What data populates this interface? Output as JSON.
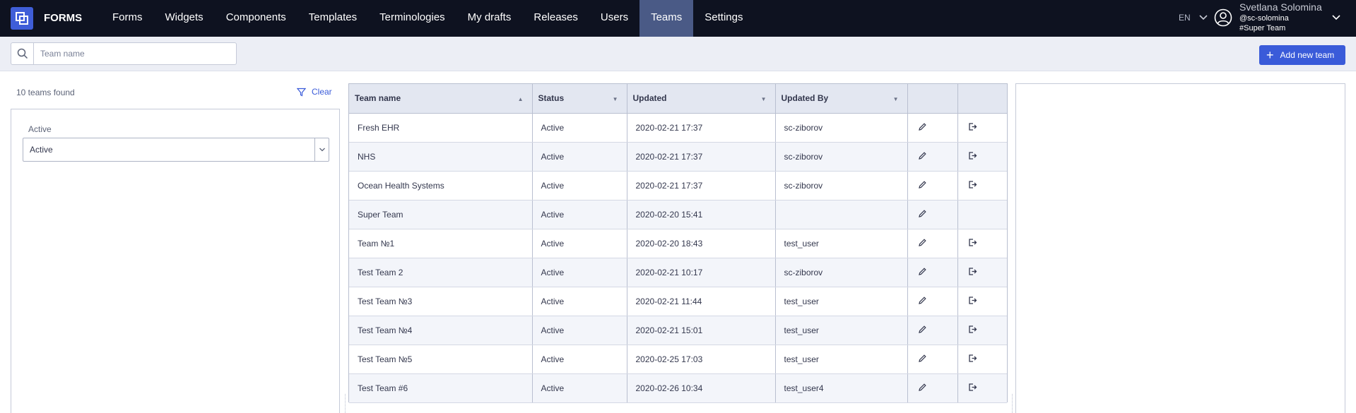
{
  "app": {
    "brand": "FORMS",
    "nav": [
      {
        "label": "Forms"
      },
      {
        "label": "Widgets"
      },
      {
        "label": "Components"
      },
      {
        "label": "Templates"
      },
      {
        "label": "Terminologies"
      },
      {
        "label": "My drafts"
      },
      {
        "label": "Releases"
      },
      {
        "label": "Users"
      },
      {
        "label": "Teams",
        "active": true
      },
      {
        "label": "Settings"
      }
    ],
    "language": "EN",
    "user": {
      "name": "Svetlana Solomina",
      "handle": "@sc-solomina",
      "team": "#Super Team"
    }
  },
  "search": {
    "placeholder": "Team name",
    "value": ""
  },
  "toolbar": {
    "add_label": "Add new team"
  },
  "filters": {
    "found_text": "10 teams found",
    "clear_label": "Clear",
    "status_label": "Active",
    "status_value": "Active"
  },
  "table": {
    "columns": [
      "Team name",
      "Status",
      "Updated",
      "Updated By"
    ],
    "sorted_column": "Team name",
    "rows": [
      {
        "name": "Fresh EHR",
        "status": "Active",
        "updated": "2020-02-21 17:37",
        "by": "sc-ziborov",
        "can_leave": true
      },
      {
        "name": "NHS",
        "status": "Active",
        "updated": "2020-02-21 17:37",
        "by": "sc-ziborov",
        "can_leave": true
      },
      {
        "name": "Ocean Health Systems",
        "status": "Active",
        "updated": "2020-02-21 17:37",
        "by": "sc-ziborov",
        "can_leave": true
      },
      {
        "name": "Super Team",
        "status": "Active",
        "updated": "2020-02-20 15:41",
        "by": "",
        "can_leave": false
      },
      {
        "name": "Team №1",
        "status": "Active",
        "updated": "2020-02-20 18:43",
        "by": "test_user",
        "can_leave": true
      },
      {
        "name": "Test Team 2",
        "status": "Active",
        "updated": "2020-02-21 10:17",
        "by": "sc-ziborov",
        "can_leave": true
      },
      {
        "name": "Test Team №3",
        "status": "Active",
        "updated": "2020-02-21 11:44",
        "by": "test_user",
        "can_leave": true
      },
      {
        "name": "Test Team №4",
        "status": "Active",
        "updated": "2020-02-21 15:01",
        "by": "test_user",
        "can_leave": true
      },
      {
        "name": "Test Team №5",
        "status": "Active",
        "updated": "2020-02-25 17:03",
        "by": "test_user",
        "can_leave": true
      },
      {
        "name": "Test Team #6",
        "status": "Active",
        "updated": "2020-02-26 10:34",
        "by": "test_user4",
        "can_leave": true
      }
    ]
  },
  "colors": {
    "topbar": "#0e1220",
    "active_nav": "#4a5a86",
    "accent": "#3a5bd9"
  }
}
